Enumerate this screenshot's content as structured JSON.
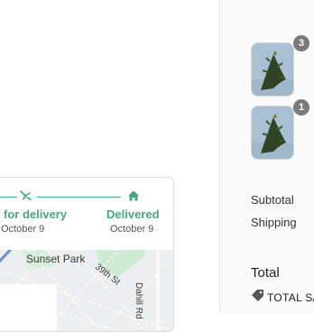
{
  "tracking": {
    "steps": [
      {
        "title": "for delivery",
        "date": "October 9"
      },
      {
        "title": "Delivered",
        "date": "October 9"
      }
    ],
    "map": {
      "labels": {
        "park": "Sunset Park",
        "street": "39th St",
        "road": "Dahill Rd"
      }
    }
  },
  "order_summary": {
    "items": [
      {
        "quantity": "3",
        "icon": "plant-product-thumbnail"
      },
      {
        "quantity": "1",
        "icon": "plant-product-thumbnail"
      }
    ],
    "subtotal_label": "Subtotal",
    "shipping_label": "Shipping",
    "total_label": "Total",
    "discount_code": "TOTAL SA"
  },
  "colors": {
    "accent": "#4aa57c",
    "badge": "#7a7a7a",
    "divider": "#e1e1e1"
  }
}
